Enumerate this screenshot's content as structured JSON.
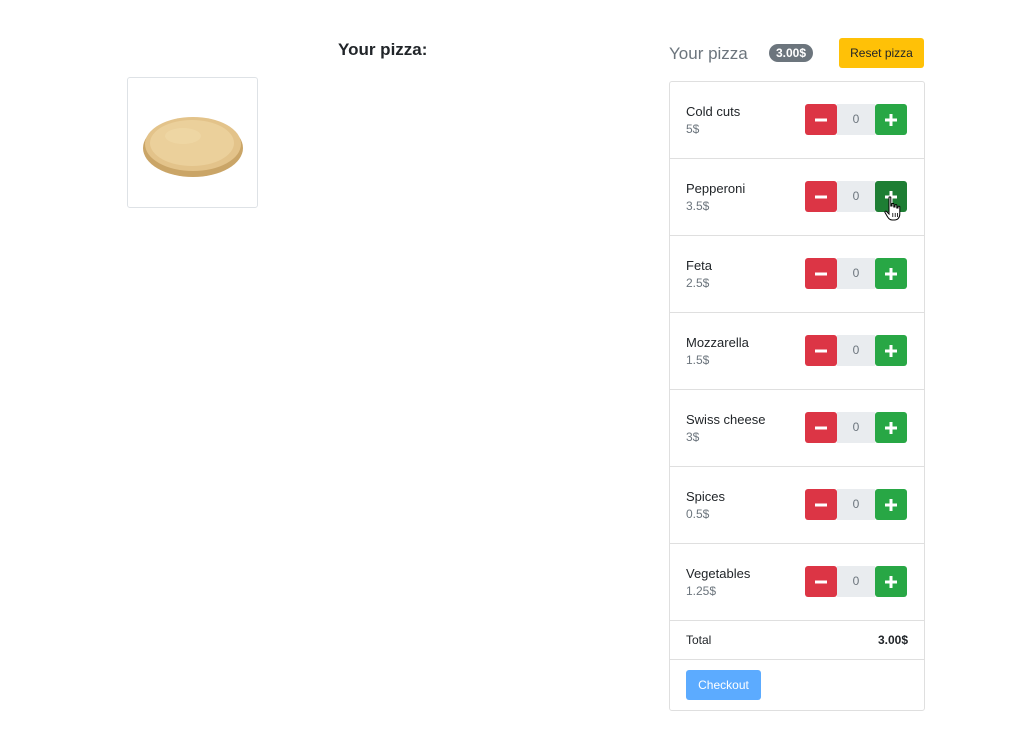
{
  "left": {
    "title": "Your pizza:"
  },
  "panel": {
    "title": "Your pizza",
    "price_badge": "3.00$",
    "reset_label": "Reset pizza"
  },
  "ingredients": [
    {
      "name": "Cold cuts",
      "price": "5$",
      "qty": "0"
    },
    {
      "name": "Pepperoni",
      "price": "3.5$",
      "qty": "0"
    },
    {
      "name": "Feta",
      "price": "2.5$",
      "qty": "0"
    },
    {
      "name": "Mozzarella",
      "price": "1.5$",
      "qty": "0"
    },
    {
      "name": "Swiss cheese",
      "price": "3$",
      "qty": "0"
    },
    {
      "name": "Spices",
      "price": "0.5$",
      "qty": "0"
    },
    {
      "name": "Vegetables",
      "price": "1.25$",
      "qty": "0"
    }
  ],
  "total": {
    "label": "Total",
    "value": "3.00$"
  },
  "checkout_label": "Checkout",
  "icons": {
    "minus": "minus-icon",
    "plus": "plus-icon",
    "cursor": "hand-pointer-icon"
  },
  "colors": {
    "minus": "#dc3545",
    "plus": "#28a745",
    "plus_active": "#1e7e34",
    "reset": "#ffc107",
    "checkout": "#5cabff",
    "badge": "#6c757d"
  }
}
